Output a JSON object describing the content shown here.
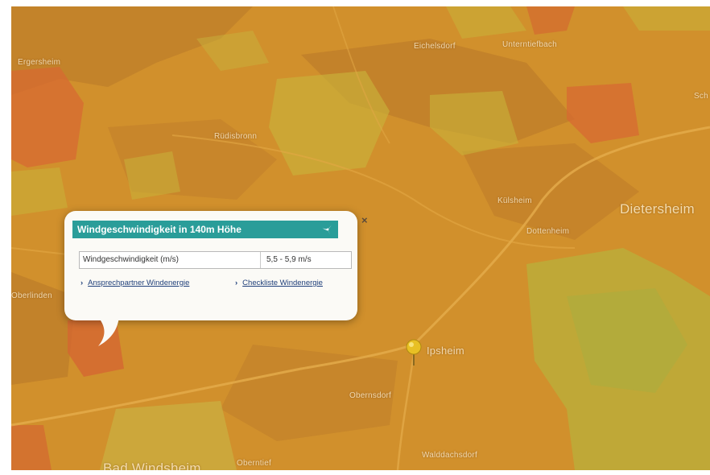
{
  "map": {
    "places": {
      "a": "Ergersheim",
      "b": "Eichelsdorf",
      "c": "Unterntiefbach",
      "d": "Rüdisbronn",
      "e": "Dietersheim",
      "f": "Dottenheim",
      "g": "Ipsheim",
      "h": "Obernsdorf",
      "i": "Bad Windsheim",
      "j": "Külsheim",
      "k": "Oberntief",
      "l": "Oberlinden",
      "m": "Walddachsdorf",
      "n": "Sch"
    }
  },
  "popup": {
    "title": "Windgeschwindigkeit in 140m Höhe",
    "row_label": "Windgeschwindigkeit (m/s)",
    "row_value": "5,5 - 5,9 m/s",
    "link1": "Ansprechpartner Windenergie",
    "link2": "Checkliste Windenergie",
    "close": "×"
  },
  "colors": {
    "popup_header": "#2a9d99",
    "map_base": "#d2922f"
  }
}
